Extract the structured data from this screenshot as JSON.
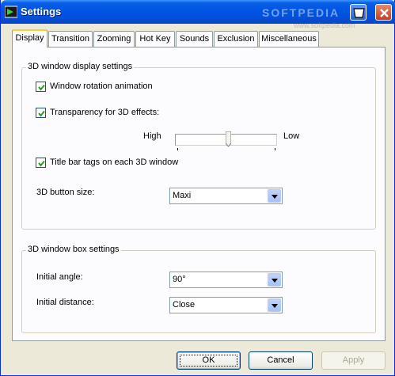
{
  "window": {
    "title": "Settings",
    "watermark": "SOFTPEDIA",
    "watermark_url": "www.softpedia.com"
  },
  "tabs": [
    {
      "label": "Display",
      "active": true
    },
    {
      "label": "Transition",
      "active": false
    },
    {
      "label": "Zooming",
      "active": false
    },
    {
      "label": "Hot Key",
      "active": false
    },
    {
      "label": "Sounds",
      "active": false
    },
    {
      "label": "Exclusion",
      "active": false
    },
    {
      "label": "Miscellaneous",
      "active": false
    }
  ],
  "display_group": {
    "title": "3D window display settings",
    "rotation_checkbox": {
      "label": "Window rotation animation",
      "checked": true
    },
    "transparency_checkbox": {
      "label": "Transparency for 3D effects:",
      "checked": true
    },
    "transparency_slider": {
      "left_label": "High",
      "right_label": "Low",
      "value": 0.52
    },
    "title_bar_checkbox": {
      "label": "Title bar tags on each 3D window",
      "checked": true
    },
    "button_size": {
      "label": "3D button size:",
      "value": "Maxi"
    }
  },
  "box_group": {
    "title": "3D window box settings",
    "initial_angle": {
      "label": "Initial angle:",
      "value": "90°"
    },
    "initial_distance": {
      "label": "Initial distance:",
      "value": "Close"
    }
  },
  "buttons": {
    "ok": "OK",
    "cancel": "Cancel",
    "apply": "Apply"
  },
  "colors": {
    "titlebar": "#0054e3",
    "tab_highlight": "#ffc83c",
    "dialog_bg": "#ece9d8"
  }
}
